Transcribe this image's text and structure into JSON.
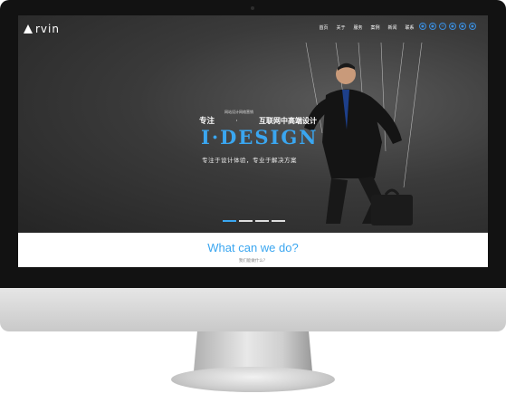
{
  "site": {
    "logo_text": "rvin",
    "nav": [
      "首页",
      "关于",
      "服务",
      "案例",
      "新闻",
      "联系"
    ],
    "social_icons": [
      "weibo-icon",
      "qq-icon",
      "mail-icon",
      "wechat-icon",
      "twitter-icon",
      "phone-icon"
    ]
  },
  "hero": {
    "small_caption": "网站设计网络营销",
    "headline_left": "专注",
    "headline_right": "互联网中高端设计",
    "brand": "I·DESIGN",
    "subline": "专注于设计体验，专业于解决方案",
    "slider_dots": 4,
    "active_slide": 1
  },
  "section": {
    "title": "What can we do?",
    "subtitle": "我们能做什么？"
  },
  "colors": {
    "accent": "#3aa6f0",
    "frame": "#121212"
  }
}
